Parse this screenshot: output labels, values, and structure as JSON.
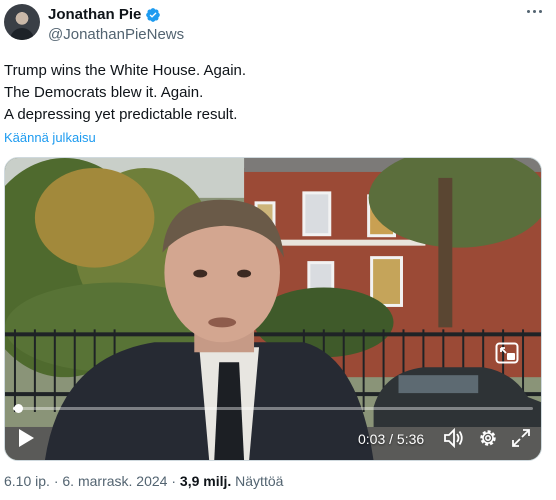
{
  "author": {
    "name": "Jonathan Pie",
    "handle": "@JonathanPieNews"
  },
  "tweet": {
    "lines": [
      "Trump wins the White House. Again.",
      "The Democrats blew it. Again.",
      "A depressing yet predictable result."
    ],
    "translate_label": "Käännä julkaisu"
  },
  "video": {
    "time_display": "0:03 / 5:36",
    "progress_fraction": 0.01,
    "icons": [
      "play-icon",
      "volume-icon",
      "settings-gear-icon",
      "fullscreen-icon",
      "picture-in-picture-icon"
    ]
  },
  "meta": {
    "time": "6.10 ip.",
    "separator": "·",
    "date": "6. marrask. 2024",
    "views_count": "3,9 milj.",
    "views_label": "Näyttöä"
  },
  "colors": {
    "link": "#1d9bf0",
    "verified": "#1d9bf0",
    "text": "#0f1419",
    "secondary": "#536471"
  }
}
